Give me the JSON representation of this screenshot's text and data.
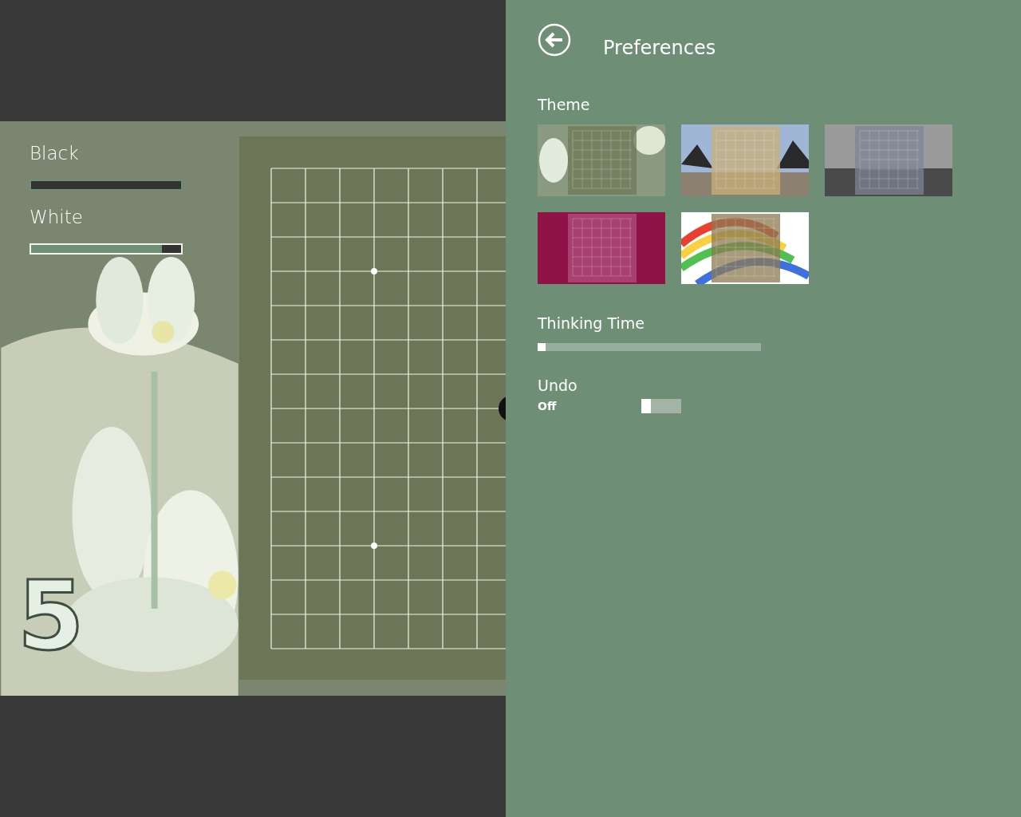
{
  "game": {
    "logo": "5",
    "players": [
      {
        "name": "Black",
        "selected": false,
        "level": 1
      },
      {
        "name": "White",
        "selected": true,
        "level": 0.13
      }
    ]
  },
  "preferences": {
    "title": "Preferences",
    "theme": {
      "label": "Theme",
      "items": [
        {
          "kind": "lotus"
        },
        {
          "kind": "beach"
        },
        {
          "kind": "mono"
        },
        {
          "kind": "magenta"
        },
        {
          "kind": "rainbow"
        }
      ]
    },
    "thinking_time": {
      "label": "Thinking Time",
      "level": 0.03
    },
    "undo": {
      "label": "Undo",
      "on": false,
      "state_text": "Off"
    }
  }
}
